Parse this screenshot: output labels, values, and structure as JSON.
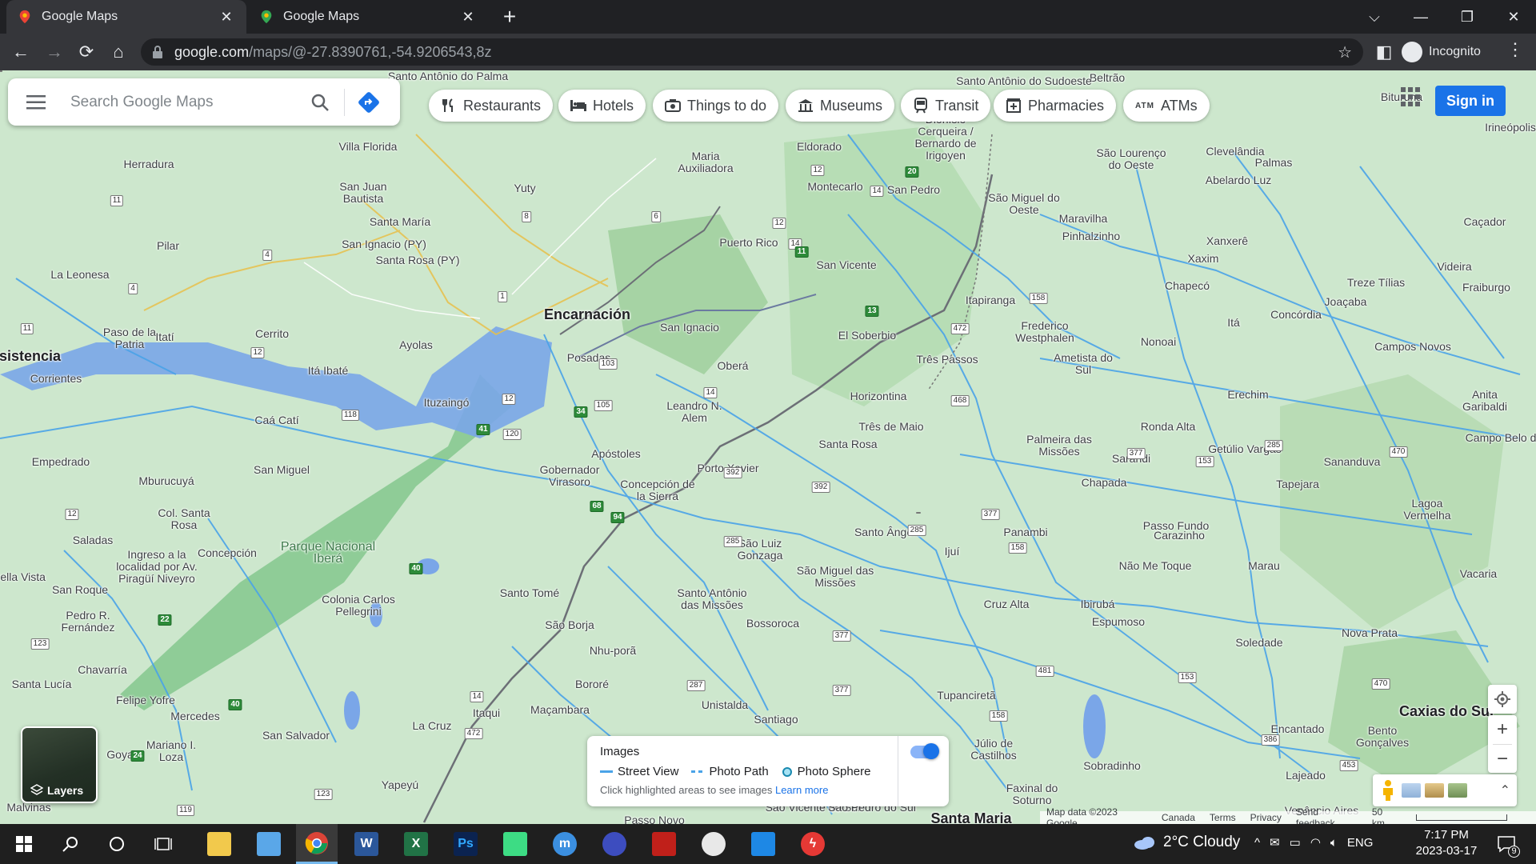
{
  "tabs": [
    {
      "title": "Google Maps",
      "active": true
    },
    {
      "title": "Google Maps",
      "active": false
    }
  ],
  "address_bar": {
    "host": "google.com",
    "path": "/maps/@-27.8390761,-54.9206543,8z"
  },
  "profile": {
    "label": "Incognito"
  },
  "search": {
    "placeholder": "Search Google Maps"
  },
  "chips": [
    {
      "label": "Restaurants",
      "icon": "fork-knife-icon"
    },
    {
      "label": "Hotels",
      "icon": "bed-icon"
    },
    {
      "label": "Things to do",
      "icon": "camera-icon"
    },
    {
      "label": "Museums",
      "icon": "museum-icon"
    },
    {
      "label": "Transit",
      "icon": "train-icon"
    },
    {
      "label": "Pharmacies",
      "icon": "pharmacy-icon"
    },
    {
      "label": "ATMs",
      "icon": "atm-icon"
    }
  ],
  "signin": {
    "label": "Sign in"
  },
  "layers": {
    "label": "Layers"
  },
  "images_panel": {
    "title": "Images",
    "legend": [
      "Street View",
      "Photo Path",
      "Photo Sphere"
    ],
    "hint": "Click highlighted areas to see images",
    "link": "Learn more",
    "toggle_on": true
  },
  "map_footer": {
    "attribution": "Map data ©2023 Google",
    "country": "Canada",
    "terms": "Terms",
    "privacy": "Privacy",
    "feedback": "Send feedback",
    "scale": "50 km"
  },
  "places": [
    {
      "name": "Encarnación",
      "big": true
    },
    {
      "name": "Posadas"
    },
    {
      "name": "Resistencia"
    },
    {
      "name": "Corrientes"
    },
    {
      "name": "Santa Rosa"
    },
    {
      "name": "Santo Ângelo"
    },
    {
      "name": "Ijuí"
    },
    {
      "name": "Cruz Alta"
    },
    {
      "name": "Passo Fundo"
    },
    {
      "name": "Erechim"
    },
    {
      "name": "Chapecó"
    },
    {
      "name": "Caxias do Sul",
      "big": true
    },
    {
      "name": "Santa Maria",
      "big": true
    },
    {
      "name": "São Borja"
    },
    {
      "name": "Santo Tomé"
    },
    {
      "name": "Apóstoles"
    },
    {
      "name": "Oberá"
    },
    {
      "name": "Ituzaingó"
    },
    {
      "name": "Parque Nacional Iberá",
      "park": true
    },
    {
      "name": "Três Passos"
    },
    {
      "name": "Frederico Westphalen"
    },
    {
      "name": "Palmeira das Missões"
    },
    {
      "name": "Carazinho"
    },
    {
      "name": "Soledade"
    },
    {
      "name": "Nova Prata"
    },
    {
      "name": "Bento Gonçalves"
    },
    {
      "name": "Vacaria"
    },
    {
      "name": "Lagoa Vermelha"
    },
    {
      "name": "Tapejara"
    },
    {
      "name": "Concórdia"
    },
    {
      "name": "Xanxerê"
    },
    {
      "name": "Xaxim"
    },
    {
      "name": "São Miguel do Oeste"
    },
    {
      "name": "São Lourenço do Oeste"
    },
    {
      "name": "Dionísio Cerqueira / Bernardo de Irigoyen"
    },
    {
      "name": "Eldorado"
    },
    {
      "name": "Montecarlo"
    },
    {
      "name": "San Pedro"
    },
    {
      "name": "Puerto Rico"
    },
    {
      "name": "San Vicente"
    },
    {
      "name": "El Soberbio"
    },
    {
      "name": "Horizontina"
    },
    {
      "name": "Três de Maio"
    },
    {
      "name": "Leandro N. Alem"
    },
    {
      "name": "San Ignacio"
    },
    {
      "name": "Gobernador Virasoro"
    },
    {
      "name": "Concepción de la Sierra"
    },
    {
      "name": "Porto Xavier"
    },
    {
      "name": "São Luiz Gonzaga"
    },
    {
      "name": "São Miguel das Missões"
    },
    {
      "name": "Santo Antônio das Missões"
    },
    {
      "name": "Bossoroca"
    },
    {
      "name": "Nhu-porã"
    },
    {
      "name": "Unistalda"
    },
    {
      "name": "Santiago"
    },
    {
      "name": "Maçambara"
    },
    {
      "name": "Itaqui"
    },
    {
      "name": "La Cruz"
    },
    {
      "name": "Yapeyú"
    },
    {
      "name": "Tupanciretã"
    },
    {
      "name": "Júlio de Castilhos"
    },
    {
      "name": "Panambi"
    },
    {
      "name": "Ibirubá"
    },
    {
      "name": "Espumoso"
    },
    {
      "name": "Sobradinho"
    },
    {
      "name": "Encantado"
    },
    {
      "name": "Lajeado"
    },
    {
      "name": "Não Me Toque"
    },
    {
      "name": "Sarandi"
    },
    {
      "name": "Chapada"
    },
    {
      "name": "Ronda Alta"
    },
    {
      "name": "Getúlio Vargas"
    },
    {
      "name": "Sananduva"
    },
    {
      "name": "Marau"
    },
    {
      "name": "Campos Novos"
    },
    {
      "name": "Anita Garibaldi"
    },
    {
      "name": "Joaçaba"
    },
    {
      "name": "Treze Tílias"
    },
    {
      "name": "Videira"
    },
    {
      "name": "Fraiburgo"
    },
    {
      "name": "Caçador"
    },
    {
      "name": "Palmas"
    },
    {
      "name": "Clevelândia"
    },
    {
      "name": "Abelardo Luz"
    },
    {
      "name": "Itapiranga"
    },
    {
      "name": "Maravilha"
    },
    {
      "name": "Pinhalzinho"
    },
    {
      "name": "Nonoai"
    },
    {
      "name": "Itá"
    },
    {
      "name": "Ametista do Sul"
    },
    {
      "name": "Maria Auxiliadora"
    },
    {
      "name": "Yuty"
    },
    {
      "name": "San Juan Bautista"
    },
    {
      "name": "Santa María"
    },
    {
      "name": "San Ignacio (PY)"
    },
    {
      "name": "Santa Rosa (PY)"
    },
    {
      "name": "Villa Florida"
    },
    {
      "name": "Herradura"
    },
    {
      "name": "Pilar"
    },
    {
      "name": "La Leonesa"
    },
    {
      "name": "Paso de la Patria"
    },
    {
      "name": "Itatí"
    },
    {
      "name": "Cerrito"
    },
    {
      "name": "Itá Ibaté"
    },
    {
      "name": "Ayolas"
    },
    {
      "name": "Caá Catí"
    },
    {
      "name": "Empedrado"
    },
    {
      "name": "Mburucuyá"
    },
    {
      "name": "San Miguel"
    },
    {
      "name": "Col. Santa Rosa"
    },
    {
      "name": "Saladas"
    },
    {
      "name": "Concepción"
    },
    {
      "name": "Ingreso a la localidad por Av. Piragüí Niveyro"
    },
    {
      "name": "Bella Vista"
    },
    {
      "name": "San Roque"
    },
    {
      "name": "Pedro R. Fernández"
    },
    {
      "name": "Colonia Carlos Pellegrini"
    },
    {
      "name": "Chavarría"
    },
    {
      "name": "Santa Lucía"
    },
    {
      "name": "Felipe Yofre"
    },
    {
      "name": "Mercedes"
    },
    {
      "name": "Mariano I. Loza"
    },
    {
      "name": "San Salvador"
    },
    {
      "name": "Goya"
    },
    {
      "name": "Malvinas"
    },
    {
      "name": "Bororé"
    },
    {
      "name": "Santo Antônio do Palma"
    },
    {
      "name": "Bituruna"
    },
    {
      "name": "Irineópolis"
    },
    {
      "name": "Beltrão"
    },
    {
      "name": "Santo Antônio do Sudoeste"
    },
    {
      "name": "Campo Belo do Sul"
    },
    {
      "name": "São Vicente do Sul"
    },
    {
      "name": "São Pedro do Sul"
    },
    {
      "name": "Faxinal do Soturno"
    },
    {
      "name": "Passo Novo"
    },
    {
      "name": "Venâncio Aires"
    }
  ],
  "taskbar": {
    "weather": "2°C  Cloudy",
    "lang": "ENG",
    "time": "7:17 PM",
    "date": "2023-03-17",
    "notifications": "9"
  }
}
